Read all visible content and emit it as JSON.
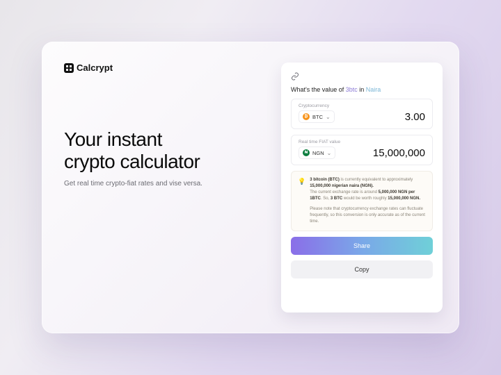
{
  "brand": {
    "name": "Calcrypt"
  },
  "hero": {
    "title_line1": "Your instant",
    "title_line2": "crypto calculator",
    "subtitle": "Get real time crypto-fiat rates and vise versa."
  },
  "card": {
    "prompt_prefix": "What's the value of ",
    "prompt_amount": "3btc",
    "prompt_mid": " in ",
    "prompt_target": "Naira",
    "crypto": {
      "label": "Cryptocurrency",
      "symbol": "BTC",
      "value": "3.00"
    },
    "fiat": {
      "label": "Real time FIAT value",
      "symbol": "NGN",
      "value": "15,000,000"
    },
    "info": {
      "l1a": "3 bitcoin (BTC)",
      "l1b": " is currently equivalent to approximately ",
      "l1c": "15,000,000 nigerian naira (NGN).",
      "l2a": "The current exchange rate is around ",
      "l2b": "5,000,000 NGN per 1BTC",
      "l2c": ". So, ",
      "l2d": "3 BTC",
      "l2e": " would be worth roughly ",
      "l2f": "15,000,000 NGN.",
      "note": "Please note that cryptocurrency exchange rates can fluctuate frequently, so this conversion is only accurate as of the current time."
    },
    "share_label": "Share",
    "copy_label": "Copy"
  }
}
